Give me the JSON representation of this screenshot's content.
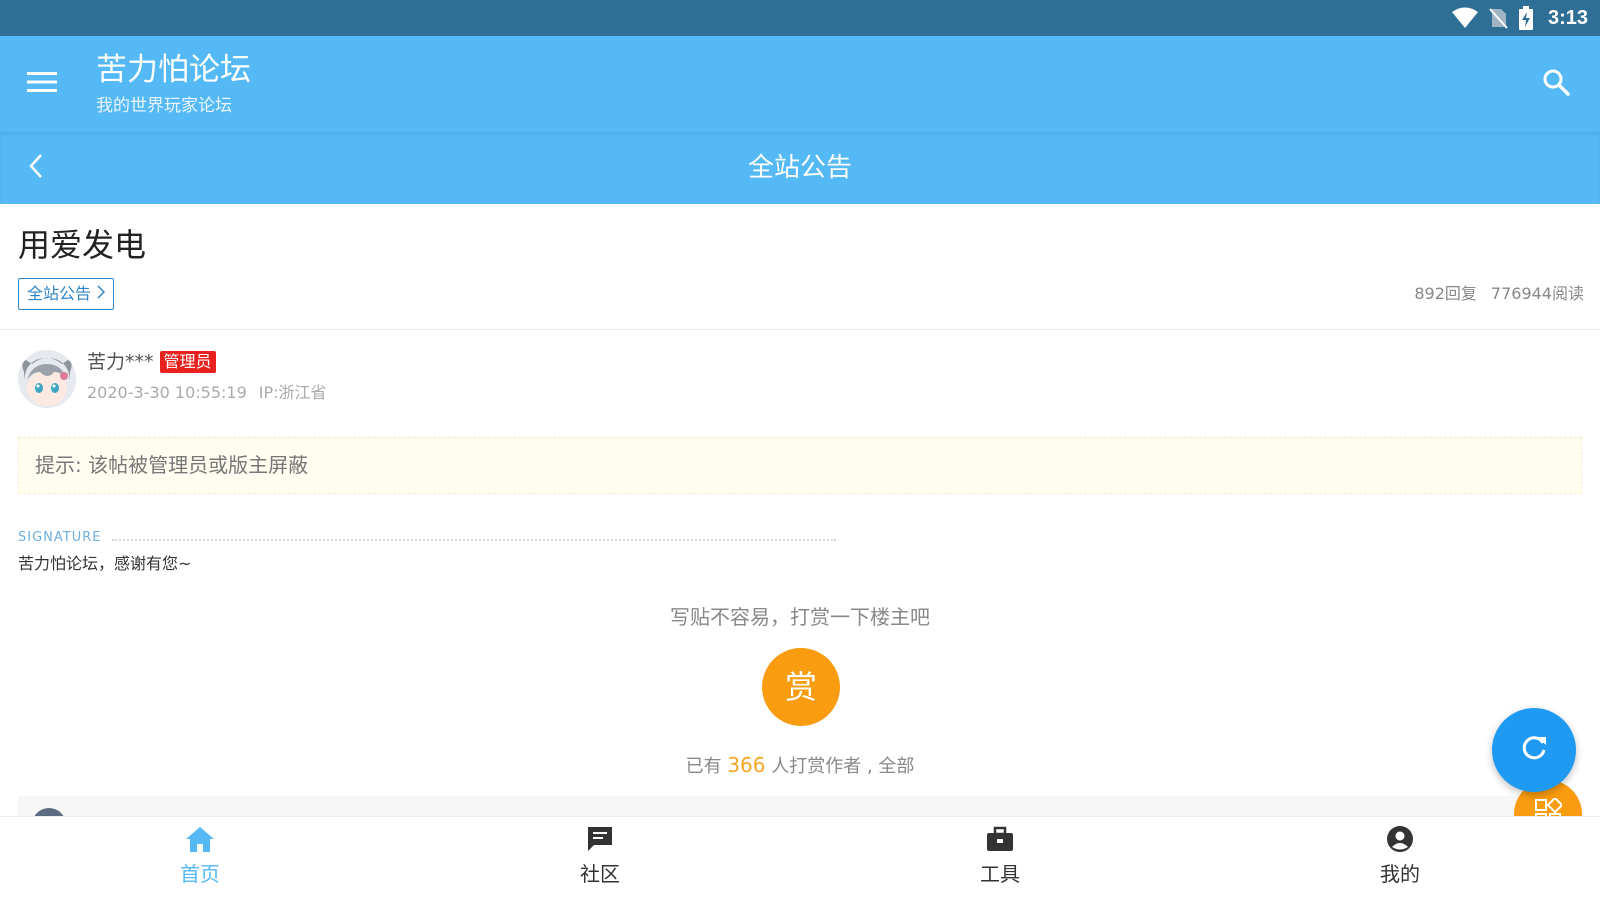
{
  "status_bar": {
    "time": "3:13",
    "icons": [
      "wifi-icon",
      "no-sim-icon",
      "battery-charging-icon"
    ]
  },
  "app_bar": {
    "title": "苦力怕论坛",
    "subtitle": "我的世界玩家论坛",
    "icons": [
      "menu-icon",
      "search-icon"
    ]
  },
  "section_bar": {
    "title": "全站公告",
    "icons": [
      "back-arrow-icon"
    ]
  },
  "post": {
    "title": "用爱发电",
    "forum_tag": "全站公告",
    "replies": "892回复",
    "views": "776944阅读"
  },
  "author": {
    "name": "苦力***",
    "badge": "管理员",
    "date": "2020-3-30 10:55:19",
    "ip": "IP:浙江省"
  },
  "notice": "提示: 该帖被管理员或版主屏蔽",
  "signature": {
    "label": "SIGNATURE",
    "text": "苦力怕论坛，感谢有您~"
  },
  "reward": {
    "prompt": "写贴不容易，打赏一下楼主吧",
    "button": "赏",
    "summary_prefix": "已有",
    "count": "366",
    "summary_suffix": "人打赏作者 , 全部"
  },
  "bottom_nav": {
    "items": [
      {
        "label": "首页",
        "icon": "home-icon",
        "active": true
      },
      {
        "label": "社区",
        "icon": "chat-icon",
        "active": false
      },
      {
        "label": "工具",
        "icon": "toolbox-icon",
        "active": false
      },
      {
        "label": "我的",
        "icon": "account-icon",
        "active": false
      }
    ]
  },
  "colors": {
    "primary": "#54b9f5",
    "status_bar": "#2f6f95",
    "accent": "#fa9c0f",
    "fab": "#1e9af3",
    "badge": "#e8201e"
  }
}
